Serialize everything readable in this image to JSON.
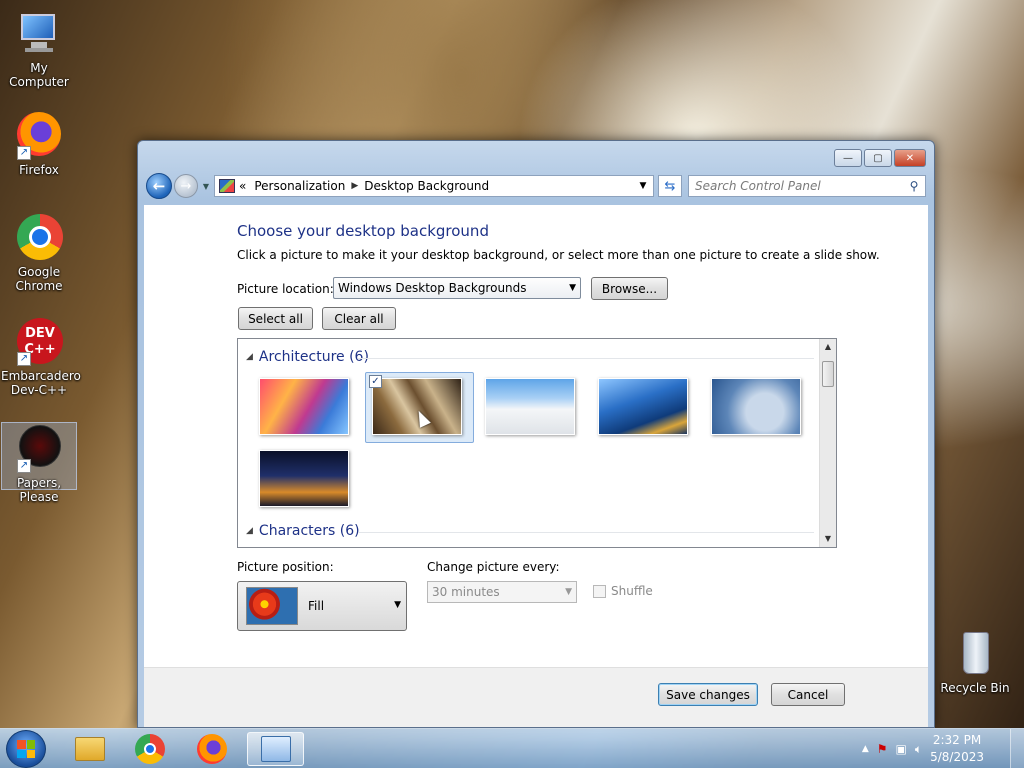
{
  "desktop": {
    "icons": [
      {
        "label": "My Computer"
      },
      {
        "label": "Firefox"
      },
      {
        "label": "Google Chrome"
      },
      {
        "label": "Embarcadero Dev-C++"
      },
      {
        "label": "Papers, Please"
      },
      {
        "label": "Recycle Bin"
      }
    ]
  },
  "window": {
    "breadcrumb": {
      "prefix": "«",
      "items": [
        "Personalization",
        "Desktop Background"
      ]
    },
    "search": {
      "placeholder": "Search Control Panel"
    },
    "title": "Choose your desktop background",
    "subtitle": "Click a picture to make it your desktop background, or select more than one picture to create a slide show.",
    "picture_location": {
      "label": "Picture location:",
      "value": "Windows Desktop Backgrounds"
    },
    "buttons": {
      "browse": "Browse...",
      "select_all": "Select all",
      "clear_all": "Clear all",
      "save": "Save changes",
      "cancel": "Cancel"
    },
    "gallery": {
      "groups": [
        {
          "name": "Architecture (6)",
          "thumbs": 6,
          "selected_index": 1
        },
        {
          "name": "Characters (6)"
        }
      ]
    },
    "picture_position": {
      "label": "Picture position:",
      "value": "Fill"
    },
    "change_every": {
      "label": "Change picture every:",
      "value": "30 minutes"
    },
    "shuffle": {
      "label": "Shuffle",
      "checked": false
    }
  },
  "taskbar": {
    "clock": {
      "time": "2:32 PM",
      "date": "5/8/2023"
    }
  }
}
